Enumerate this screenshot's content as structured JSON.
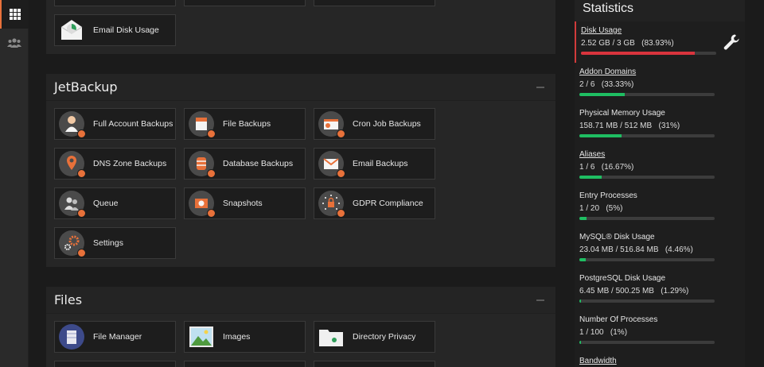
{
  "rail": {
    "items": [
      {
        "icon": "grid-icon",
        "active": true
      },
      {
        "icon": "users-icon",
        "active": false
      }
    ]
  },
  "sections": [
    {
      "key": "email_tail",
      "title": "",
      "tiles": [
        {
          "label": "Email Disk Usage",
          "icon": "email-disk-usage-icon"
        }
      ]
    },
    {
      "key": "jetbackup",
      "title": "JetBackup",
      "tiles": [
        {
          "label": "Full Account Backups",
          "icon": "full-account-backups-icon"
        },
        {
          "label": "File Backups",
          "icon": "file-backups-icon"
        },
        {
          "label": "Cron Job Backups",
          "icon": "cron-job-backups-icon"
        },
        {
          "label": "DNS Zone Backups",
          "icon": "dns-zone-backups-icon"
        },
        {
          "label": "Database Backups",
          "icon": "database-backups-icon"
        },
        {
          "label": "Email Backups",
          "icon": "email-backups-icon"
        },
        {
          "label": "Queue",
          "icon": "queue-icon"
        },
        {
          "label": "Snapshots",
          "icon": "snapshots-icon"
        },
        {
          "label": "GDPR Compliance",
          "icon": "gdpr-compliance-icon"
        },
        {
          "label": "Settings",
          "icon": "settings-icon"
        }
      ]
    },
    {
      "key": "files",
      "title": "Files",
      "tiles": [
        {
          "label": "File Manager",
          "icon": "file-manager-icon"
        },
        {
          "label": "Images",
          "icon": "images-icon"
        },
        {
          "label": "Directory Privacy",
          "icon": "directory-privacy-icon"
        }
      ]
    }
  ],
  "statistics": {
    "title": "Statistics",
    "items": [
      {
        "name": "Disk Usage",
        "value": "2.52 GB / 3 GB   (83.93%)",
        "percent": 83.93,
        "link": true,
        "alert": true
      },
      {
        "name": "Addon Domains",
        "value": "2 / 6   (33.33%)",
        "percent": 33.33,
        "link": true,
        "alert": false
      },
      {
        "name": "Physical Memory Usage",
        "value": "158.71 MB / 512 MB   (31%)",
        "percent": 31,
        "link": false,
        "alert": false
      },
      {
        "name": "Aliases",
        "value": "1 / 6   (16.67%)",
        "percent": 16.67,
        "link": true,
        "alert": false
      },
      {
        "name": "Entry Processes",
        "value": "1 / 20   (5%)",
        "percent": 5,
        "link": false,
        "alert": false
      },
      {
        "name": "MySQL® Disk Usage",
        "value": "23.04 MB / 516.84 MB   (4.46%)",
        "percent": 4.46,
        "link": false,
        "alert": false
      },
      {
        "name": "PostgreSQL Disk Usage",
        "value": "6.45 MB / 500.25 MB   (1.29%)",
        "percent": 1.29,
        "link": false,
        "alert": false
      },
      {
        "name": "Number Of Processes",
        "value": "1 / 100   (1%)",
        "percent": 1,
        "link": false,
        "alert": false
      },
      {
        "name": "Bandwidth",
        "value": "",
        "percent": null,
        "link": true,
        "alert": false
      }
    ]
  },
  "colors": {
    "accent": "#e8713a",
    "bar_ok": "#1fbe62",
    "bar_alert": "#d9343d"
  }
}
